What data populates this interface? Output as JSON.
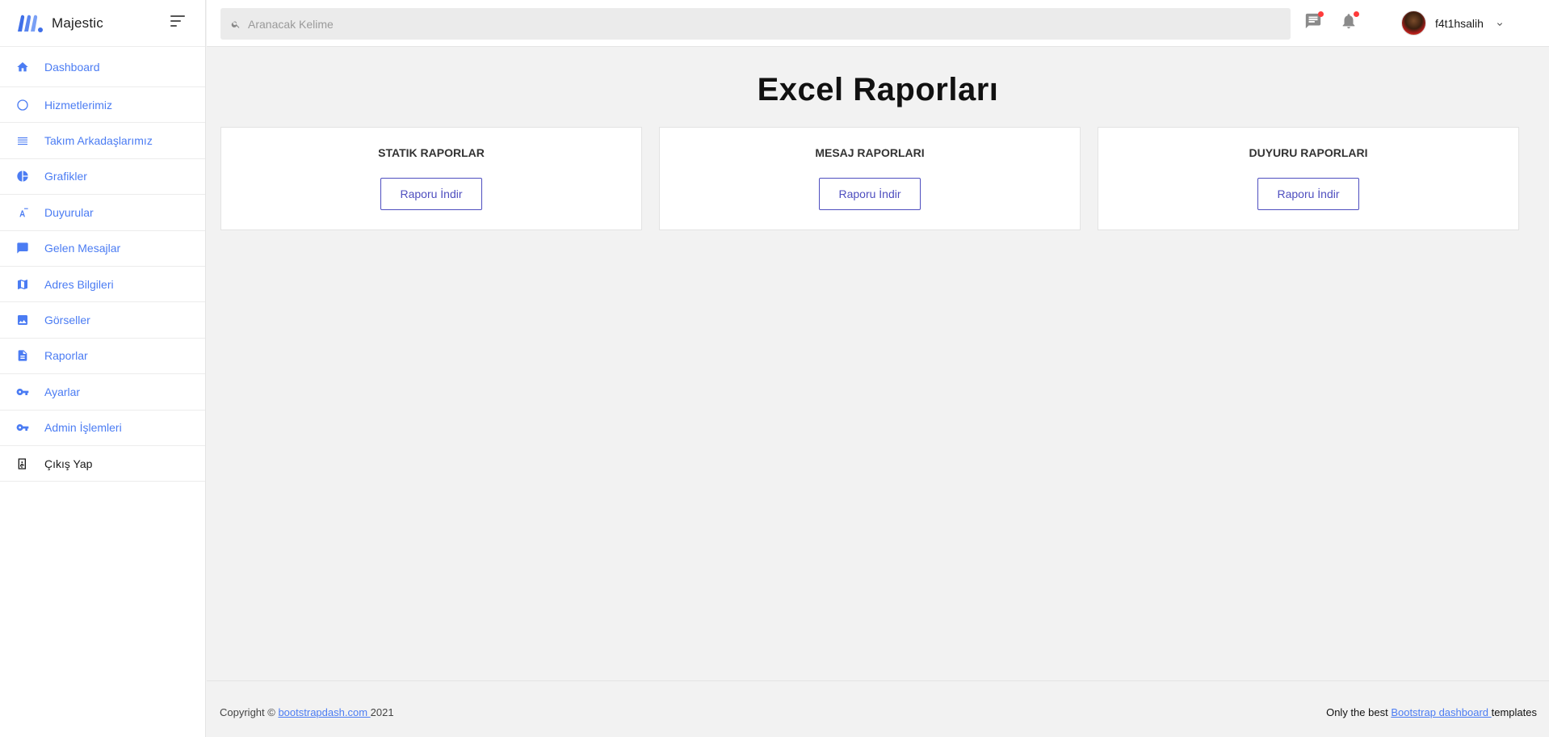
{
  "brand": {
    "name": "Majestic",
    "logo_icon": "majestic-m-logo"
  },
  "sidebar": {
    "items": [
      {
        "label": "Dashboard",
        "icon": "home-icon"
      },
      {
        "label": "Hizmetlerimiz",
        "icon": "circle-outline-icon"
      },
      {
        "label": "Takım Arkadaşlarımız",
        "icon": "list-icon"
      },
      {
        "label": "Grafikler",
        "icon": "pie-chart-icon"
      },
      {
        "label": "Duyurular",
        "icon": "text-format-icon"
      },
      {
        "label": "Gelen Mesajlar",
        "icon": "message-icon"
      },
      {
        "label": "Adres Bilgileri",
        "icon": "map-icon"
      },
      {
        "label": "Görseller",
        "icon": "image-icon"
      },
      {
        "label": "Raporlar",
        "icon": "document-icon"
      },
      {
        "label": "Ayarlar",
        "icon": "key-icon"
      },
      {
        "label": "Admin İşlemleri",
        "icon": "key-icon"
      },
      {
        "label": "Çıkış Yap",
        "icon": "exit-icon"
      }
    ]
  },
  "topbar": {
    "search_placeholder": "Aranacak Kelime",
    "username": "f4t1hsalih"
  },
  "main": {
    "title": "Excel Raporları",
    "cards": [
      {
        "title": "STATIK RAPORLAR",
        "button": "Raporu İndir"
      },
      {
        "title": "MESAJ RAPORLARI",
        "button": "Raporu İndir"
      },
      {
        "title": "DUYURU RAPORLARI",
        "button": "Raporu İndir"
      }
    ]
  },
  "footer": {
    "left_prefix": "Copyright © ",
    "left_link": "bootstrapdash.com ",
    "left_suffix": "2021",
    "right_prefix": "Only the best ",
    "right_link": "Bootstrap dashboard ",
    "right_suffix": "templates"
  },
  "colors": {
    "accent": "#4b7cf3",
    "button_border": "#4e4ebf",
    "notification_dot": "#ff3b3b"
  }
}
